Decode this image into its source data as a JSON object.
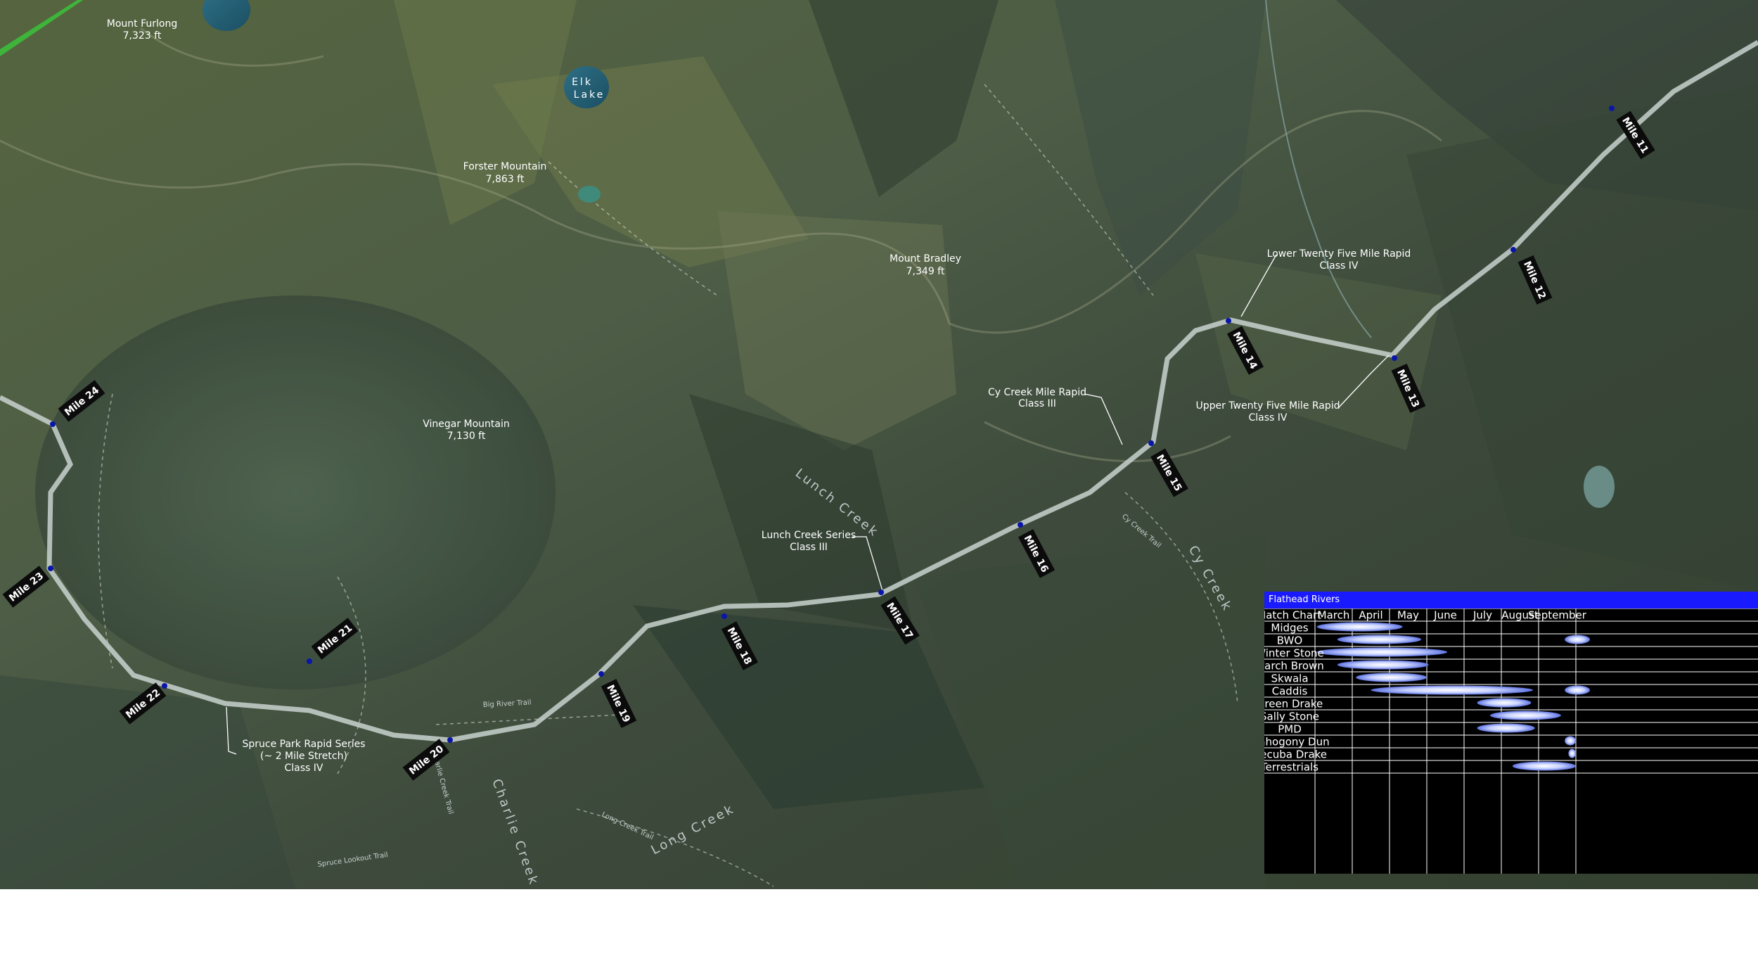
{
  "peaks": [
    {
      "id": "furlong",
      "name": "Mount Furlong",
      "elev": "7,323 ft"
    },
    {
      "id": "forster",
      "name": "Forster Mountain",
      "elev": "7,863 ft"
    },
    {
      "id": "bradley",
      "name": "Mount Bradley",
      "elev": "7,349 ft"
    },
    {
      "id": "vinegar",
      "name": "Vinegar Mountain",
      "elev": "7,130 ft"
    }
  ],
  "lakes": [
    {
      "id": "elk",
      "line1": "Elk",
      "line2": "Lake"
    }
  ],
  "rapids": [
    {
      "id": "lower-25",
      "name": "Lower Twenty Five Mile Rapid",
      "class": "Class IV"
    },
    {
      "id": "upper-25",
      "name": "Upper Twenty Five Mile Rapid",
      "class": "Class IV"
    },
    {
      "id": "cy-creek",
      "name": "Cy Creek Mile Rapid",
      "class": "Class III"
    },
    {
      "id": "lunch-creek",
      "name": "Lunch Creek Series",
      "class": "Class III"
    },
    {
      "id": "spruce-park",
      "name": "Spruce Park Rapid Series",
      "note": "(~ 2 Mile Stretch)",
      "class": "Class IV"
    }
  ],
  "creeks": [
    {
      "id": "lunch",
      "name": "Lunch Creek"
    },
    {
      "id": "cy",
      "name": "Cy Creek"
    },
    {
      "id": "charlie",
      "name": "Charlie Creek"
    },
    {
      "id": "long",
      "name": "Long Creek"
    }
  ],
  "trails": [
    {
      "id": "big-river",
      "name": "Big River Trail"
    },
    {
      "id": "cy-creek",
      "name": "Cy Creek Trail"
    },
    {
      "id": "charlie",
      "name": "Charlie Creek Trail"
    },
    {
      "id": "spruce-lookout",
      "name": "Spruce Lookout Trail"
    },
    {
      "id": "long-creek",
      "name": "Long Creek Trail"
    }
  ],
  "miles": [
    "Mile 11",
    "Mile 12",
    "Mile 13",
    "Mile 14",
    "Mile 15",
    "Mile 16",
    "Mile 17",
    "Mile 18",
    "Mile 19",
    "Mile 20",
    "Mile 21",
    "Mile 22",
    "Mile 23",
    "Mile 24"
  ],
  "hatch_chart": {
    "title": "Flathead Rivers",
    "header_label": "Hatch Chart",
    "months": [
      "March",
      "April",
      "May",
      "June",
      "July",
      "August",
      "September"
    ],
    "insects": [
      {
        "name": "Midges",
        "start": 0.05,
        "end": 2.35
      },
      {
        "name": "BWO",
        "start": 0.6,
        "end": 2.85
      },
      {
        "name": "Winter Stone",
        "start": 0.05,
        "end": 3.55
      },
      {
        "name": "March Brown",
        "start": 0.6,
        "end": 3.05
      },
      {
        "name": "Skwala",
        "start": 1.1,
        "end": 3.0
      },
      {
        "name": "Caddis",
        "start": 1.5,
        "end": 5.85
      },
      {
        "name": "Green Drake",
        "start": 4.35,
        "end": 5.8
      },
      {
        "name": "Sally Stone",
        "start": 4.7,
        "end": 6.6
      },
      {
        "name": "PMD",
        "start": 4.35,
        "end": 5.9
      },
      {
        "name": "Mahogony Dun",
        "start": 6.7,
        "end": 7.0
      },
      {
        "name": "Hecuba Drake",
        "start": 6.8,
        "end": 7.0
      },
      {
        "name": "Terrestrials",
        "start": 5.3,
        "end": 7.0
      }
    ],
    "extra_bars": [
      {
        "row": 1,
        "start": 6.7,
        "end": 7.0
      },
      {
        "row": 5,
        "start": 6.7,
        "end": 7.0
      }
    ]
  },
  "colors": {
    "bar": "#6a7fe0",
    "header": "#1a1aff",
    "river": "#c9d2cf",
    "marker": "#0a16a8"
  }
}
